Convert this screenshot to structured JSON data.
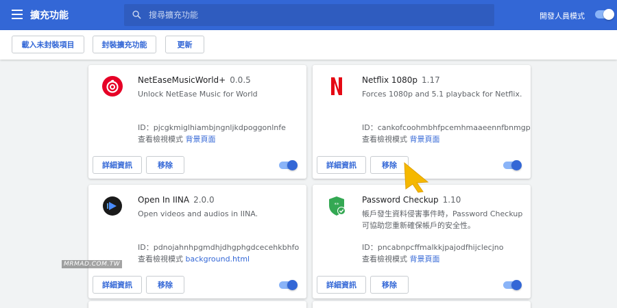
{
  "header": {
    "title": "擴充功能",
    "search_placeholder": "搜尋擴充功能",
    "dev_mode_label": "開發人員模式",
    "dev_mode_on": true
  },
  "toolbar": {
    "load_unpacked": "載入未封裝項目",
    "pack_extension": "封裝擴充功能",
    "update": "更新"
  },
  "colors": {
    "accent": "#3367d6",
    "toggle_track": "#8ab4f8"
  },
  "extensions": [
    {
      "name": "NetEaseMusicWorld+",
      "version": "0.0.5",
      "description": "Unlock NetEase Music for World",
      "id": "ID：pjcgkmiglhiambjngnljkdpoggonlnfe",
      "inspect_label": "查看檢視模式",
      "inspect_link": "背景頁面",
      "icon": "netease-music-icon",
      "enabled": true
    },
    {
      "name": "Netflix 1080p",
      "version": "1.17",
      "description": "Forces 1080p and 5.1 playback for Netflix.",
      "id": "ID：cankofcoohmbhfpcemhmaaeennfbnmgp",
      "inspect_label": "查看檢視模式",
      "inspect_link": "背景頁面",
      "icon": "netflix-icon",
      "enabled": true
    },
    {
      "name": "Open In IINA",
      "version": "2.0.0",
      "description": "Open videos and audios in IINA.",
      "id": "ID：pdnojahnhpgmdhjdhgphgdcecehkbhfo",
      "inspect_label": "查看檢視模式",
      "inspect_link": "background.html",
      "icon": "iina-play-icon",
      "enabled": true
    },
    {
      "name": "Password Checkup",
      "version": "1.10",
      "description": "帳戶發生資料侵害事件時，Password Checkup 可協助您重新確保帳戶的安全性。",
      "id": "ID：pncabnpcffmalkkjpajodfhijclecjno",
      "inspect_label": "查看檢視模式",
      "inspect_link": "背景頁面",
      "icon": "password-shield-icon",
      "enabled": true
    }
  ],
  "card_buttons": {
    "details": "詳細資訊",
    "remove": "移除"
  },
  "watermark": "MRMAD.COM.TW"
}
